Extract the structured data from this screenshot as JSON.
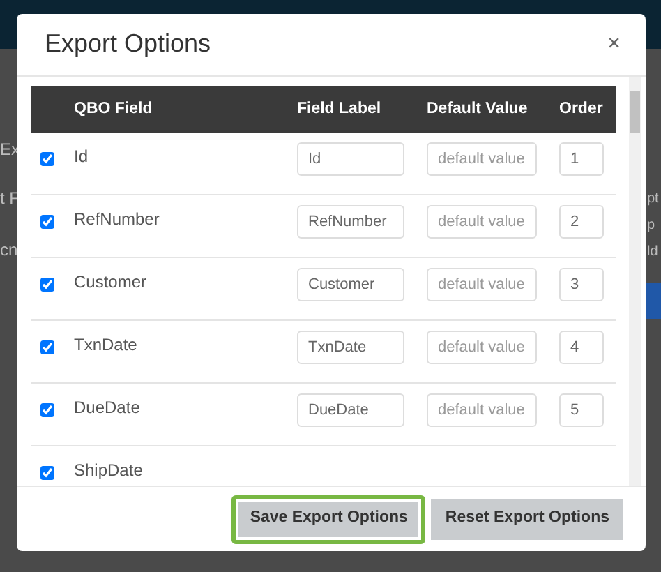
{
  "background": {
    "left_fragments": [
      "Ex",
      "t F",
      "cn"
    ],
    "right_fragments": [
      "pt",
      "p",
      "ld"
    ]
  },
  "dialog": {
    "title": "Export Options",
    "close": "×"
  },
  "table": {
    "columns": [
      "QBO Field",
      "Field Label",
      "Default Value",
      "Order"
    ],
    "rows": [
      {
        "checked": true,
        "qbo_field": "Id",
        "field_label": "Id",
        "default_placeholder": "default value",
        "order": "1"
      },
      {
        "checked": true,
        "qbo_field": "RefNumber",
        "field_label": "RefNumber",
        "default_placeholder": "default value",
        "order": "2"
      },
      {
        "checked": true,
        "qbo_field": "Customer",
        "field_label": "Customer",
        "default_placeholder": "default value",
        "order": "3"
      },
      {
        "checked": true,
        "qbo_field": "TxnDate",
        "field_label": "TxnDate",
        "default_placeholder": "default value",
        "order": "4"
      },
      {
        "checked": true,
        "qbo_field": "DueDate",
        "field_label": "DueDate",
        "default_placeholder": "default value",
        "order": "5"
      },
      {
        "checked": true,
        "qbo_field": "ShipDate"
      }
    ]
  },
  "buttons": [
    {
      "label": "Save Export Options",
      "focused": true
    },
    {
      "label": "Reset Export Options",
      "focused": false
    }
  ]
}
